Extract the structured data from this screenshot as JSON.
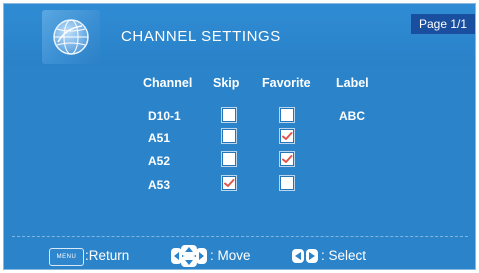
{
  "header": {
    "title": "CHANNEL SETTINGS",
    "page_indicator": "Page 1/1",
    "logo_icon": "globe-icon"
  },
  "table": {
    "columns": [
      "Channel",
      "Skip",
      "Favorite",
      "Label"
    ],
    "rows": [
      {
        "channel": "D10-1",
        "skip": false,
        "favorite": false,
        "label": "ABC"
      },
      {
        "channel": "A51",
        "skip": false,
        "favorite": true,
        "label": ""
      },
      {
        "channel": "A52",
        "skip": false,
        "favorite": true,
        "label": ""
      },
      {
        "channel": "A53",
        "skip": true,
        "favorite": false,
        "label": ""
      }
    ]
  },
  "footer": {
    "menu_key": "MENU",
    "return_label": ":Return",
    "move_label": ": Move",
    "select_label": ": Select",
    "move_icon": "four-way-arrows-icon",
    "select_icon": "left-right-arrows-icon"
  },
  "colors": {
    "background": "#2b84ca",
    "badge": "#1a4f9f",
    "check": "#e0564d"
  }
}
